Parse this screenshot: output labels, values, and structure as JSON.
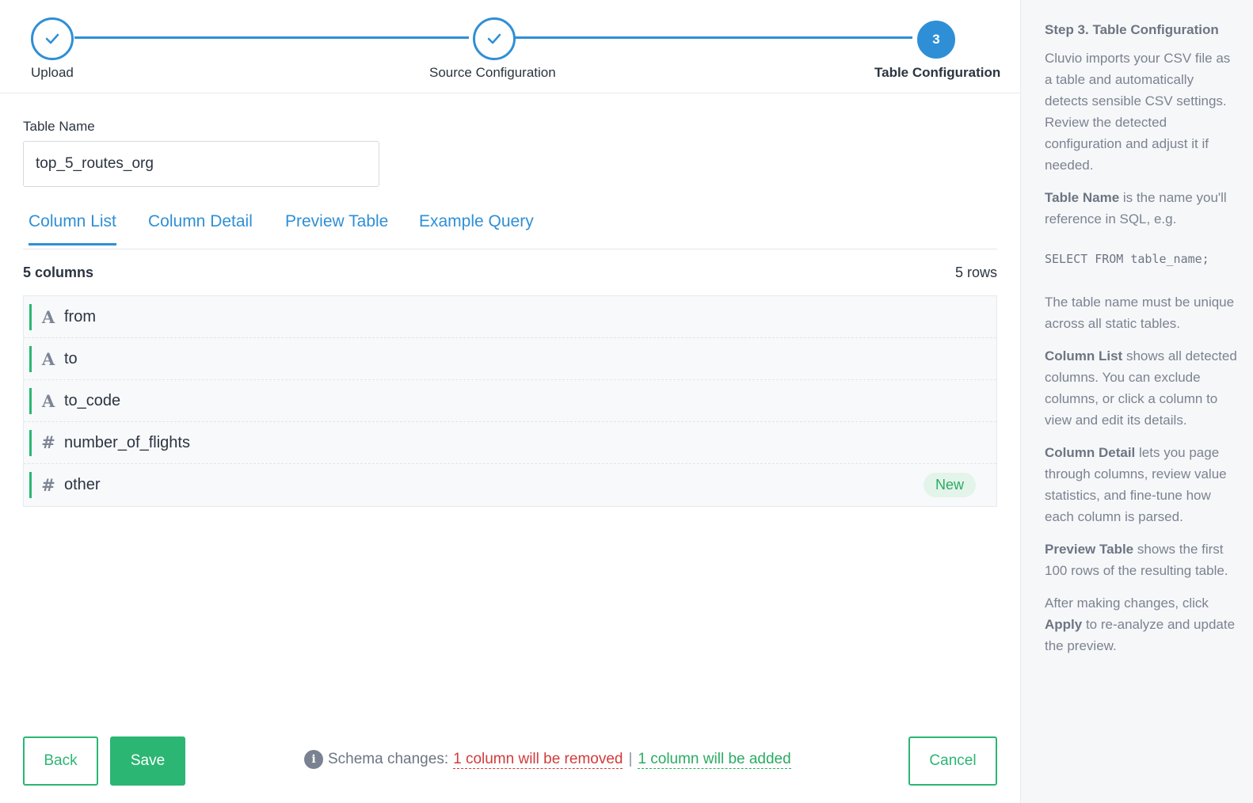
{
  "stepper": {
    "steps": [
      {
        "label": "Upload",
        "state": "done"
      },
      {
        "label": "Source Configuration",
        "state": "done"
      },
      {
        "label": "Table Configuration",
        "state": "active",
        "number": "3"
      }
    ]
  },
  "form": {
    "table_name_label": "Table Name",
    "table_name_value": "top_5_routes_org"
  },
  "tabs": [
    "Column List",
    "Column Detail",
    "Preview Table",
    "Example Query"
  ],
  "summary": {
    "columns": "5 columns",
    "rows": "5 rows"
  },
  "columns": [
    {
      "name": "from",
      "type_glyph": "A",
      "type": "text"
    },
    {
      "name": "to",
      "type_glyph": "A",
      "type": "text"
    },
    {
      "name": "to_code",
      "type_glyph": "A",
      "type": "text"
    },
    {
      "name": "number_of_flights",
      "type_glyph": "#",
      "type": "number"
    },
    {
      "name": "other",
      "type_glyph": "#",
      "type": "number",
      "badge": "New"
    }
  ],
  "footer": {
    "back_label": "Back",
    "save_label": "Save",
    "cancel_label": "Cancel",
    "schema_prefix": "Schema changes:",
    "removed_text": "1 column will be removed",
    "separator": "|",
    "added_text": "1 column will be added",
    "info_glyph": "i"
  },
  "sidebar": {
    "title": "Step 3. Table Configuration",
    "intro": "Cluvio imports your CSV file as a table and automatically detects sensible CSV settings. Review the detected configuration and adjust it if needed.",
    "table_name_term": "Table Name",
    "table_name_desc": " is the name you'll reference in SQL, e.g.",
    "sql_example": "SELECT FROM table_name;",
    "unique_note": "The table name must be unique across all static tables.",
    "column_list_term": "Column List",
    "column_list_desc": " shows all detected columns. You can exclude columns, or click a column to view and edit its details.",
    "column_detail_term": "Column Detail",
    "column_detail_desc": " lets you page through columns, review value statistics, and fine-tune how each column is parsed.",
    "preview_term": "Preview Table",
    "preview_desc": " shows the first 100 rows of the resulting table.",
    "apply_prefix": "After making changes, click ",
    "apply_term": "Apply",
    "apply_suffix": " to re-analyze and update the preview."
  },
  "colors": {
    "accent_blue": "#2f8fd6",
    "accent_green": "#2bb673",
    "removed_red": "#d23b3b"
  }
}
